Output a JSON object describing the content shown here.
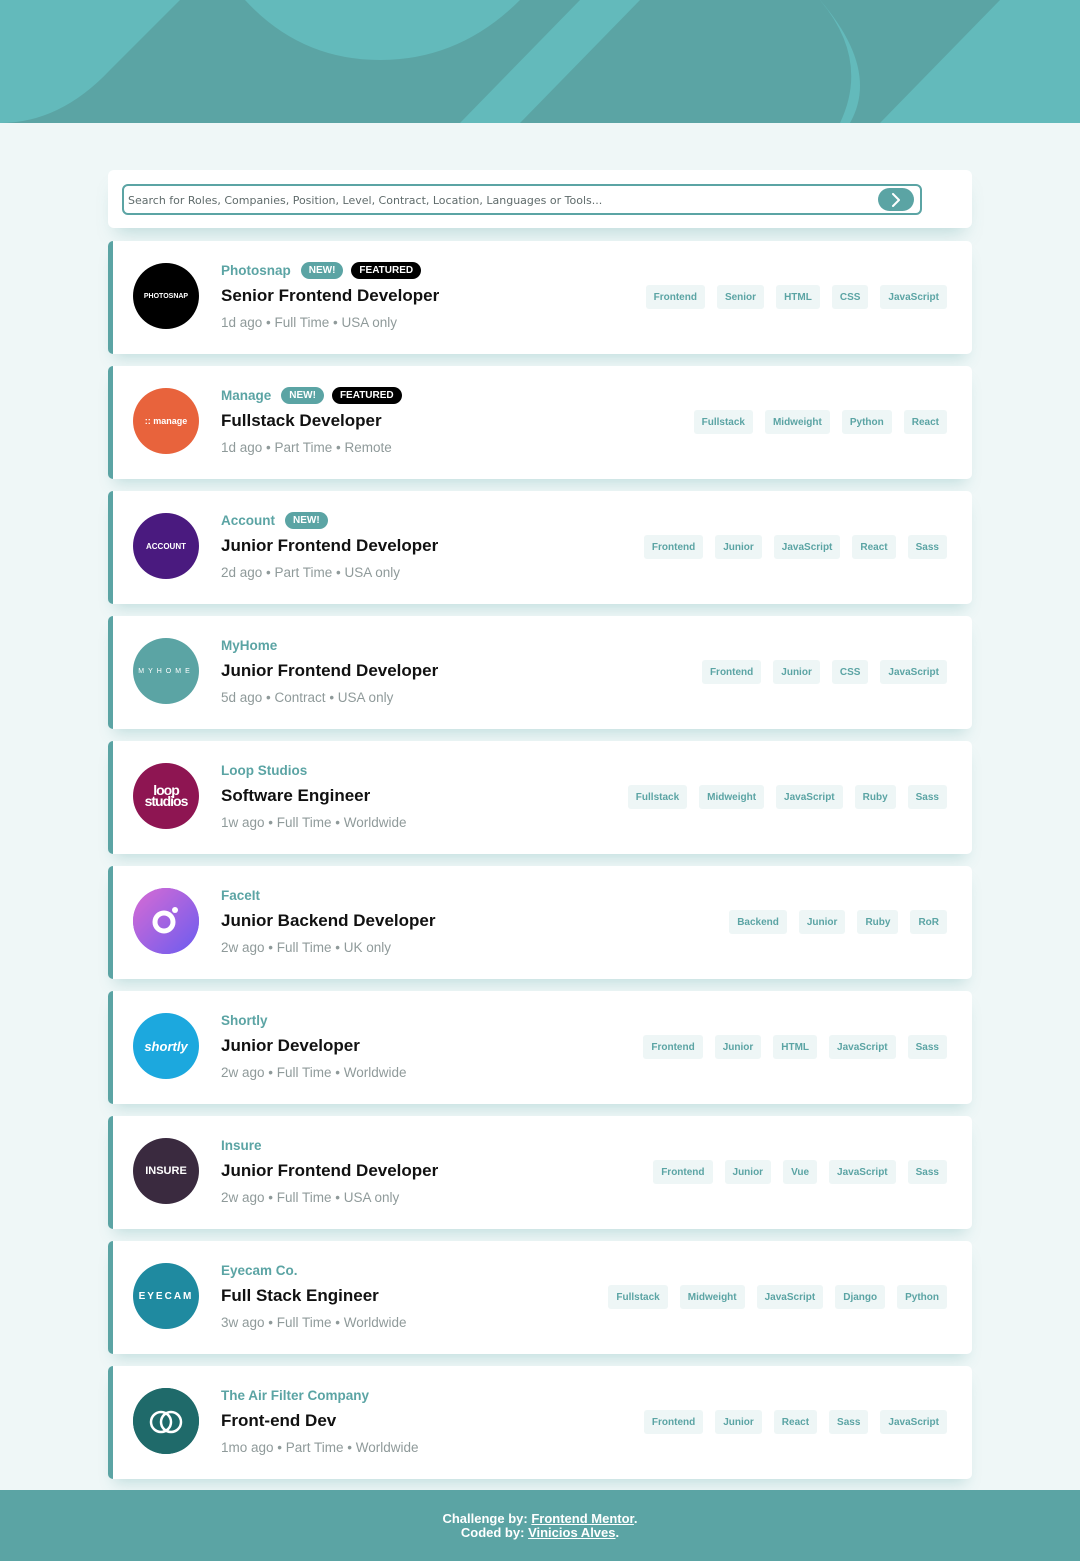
{
  "colors": {
    "primary": "#5ba4a4",
    "background": "#eff7f7",
    "tag_background": "#eef6f6",
    "featured": "#000000",
    "header_light": "#63babb"
  },
  "search": {
    "placeholder": "Search for Roles, Companies, Position, Level, Contract, Location, Languages or Tools...",
    "value": "",
    "button_icon": "chevron-right-icon"
  },
  "jobs": [
    {
      "company": "Photosnap",
      "new": "NEW!",
      "featured": "FEATURED",
      "position": "Senior Frontend Developer",
      "posted": "1d ago",
      "contract": "Full Time",
      "location": "USA only",
      "logo_text": "PHOTOSNAP",
      "logo_color": "#000000",
      "tags": [
        "Frontend",
        "Senior",
        "HTML",
        "CSS",
        "JavaScript"
      ]
    },
    {
      "company": "Manage",
      "new": "NEW!",
      "featured": "FEATURED",
      "position": "Fullstack Developer",
      "posted": "1d ago",
      "contract": "Part Time",
      "location": "Remote",
      "logo_text": ":: manage",
      "logo_color": "#e8633c",
      "tags": [
        "Fullstack",
        "Midweight",
        "Python",
        "React"
      ]
    },
    {
      "company": "Account",
      "new": "NEW!",
      "featured": "",
      "position": "Junior Frontend Developer",
      "posted": "2d ago",
      "contract": "Part Time",
      "location": "USA only",
      "logo_text": "ACCOUNT",
      "logo_color": "#4a1a7f",
      "tags": [
        "Frontend",
        "Junior",
        "JavaScript",
        "React",
        "Sass"
      ]
    },
    {
      "company": "MyHome",
      "new": "",
      "featured": "",
      "position": "Junior Frontend Developer",
      "posted": "5d ago",
      "contract": "Contract",
      "location": "USA only",
      "logo_text": "MYHOME",
      "logo_color": "#5ba4a4",
      "tags": [
        "Frontend",
        "Junior",
        "CSS",
        "JavaScript"
      ]
    },
    {
      "company": "Loop Studios",
      "new": "",
      "featured": "",
      "position": "Software Engineer",
      "posted": "1w ago",
      "contract": "Full Time",
      "location": "Worldwide",
      "logo_text": "loop studios",
      "logo_color": "#8e1552",
      "tags": [
        "Fullstack",
        "Midweight",
        "JavaScript",
        "Ruby",
        "Sass"
      ]
    },
    {
      "company": "FaceIt",
      "new": "",
      "featured": "",
      "position": "Junior Backend Developer",
      "posted": "2w ago",
      "contract": "Full Time",
      "location": "UK only",
      "logo_text": "",
      "logo_color": "#9b5de5",
      "tags": [
        "Backend",
        "Junior",
        "Ruby",
        "RoR"
      ]
    },
    {
      "company": "Shortly",
      "new": "",
      "featured": "",
      "position": "Junior Developer",
      "posted": "2w ago",
      "contract": "Full Time",
      "location": "Worldwide",
      "logo_text": "shortly",
      "logo_color": "#1ca8de",
      "tags": [
        "Frontend",
        "Junior",
        "HTML",
        "JavaScript",
        "Sass"
      ]
    },
    {
      "company": "Insure",
      "new": "",
      "featured": "",
      "position": "Junior Frontend Developer",
      "posted": "2w ago",
      "contract": "Full Time",
      "location": "USA only",
      "logo_text": "INSURE",
      "logo_color": "#3a2a3f",
      "tags": [
        "Frontend",
        "Junior",
        "Vue",
        "JavaScript",
        "Sass"
      ]
    },
    {
      "company": "Eyecam Co.",
      "new": "",
      "featured": "",
      "position": "Full Stack Engineer",
      "posted": "3w ago",
      "contract": "Full Time",
      "location": "Worldwide",
      "logo_text": "EYECAM",
      "logo_color": "#1f8aa0",
      "tags": [
        "Fullstack",
        "Midweight",
        "JavaScript",
        "Django",
        "Python"
      ]
    },
    {
      "company": "The Air Filter Company",
      "new": "",
      "featured": "",
      "position": "Front-end Dev",
      "posted": "1mo ago",
      "contract": "Part Time",
      "location": "Worldwide",
      "logo_text": "",
      "logo_color": "#1f6a6a",
      "tags": [
        "Frontend",
        "Junior",
        "React",
        "Sass",
        "JavaScript"
      ]
    }
  ],
  "footer": {
    "challenge_prefix": "Challenge by:",
    "challenge_link": "Frontend Mentor",
    "coded_prefix": "Coded by:",
    "coded_link": "Vinicios Alves",
    "period": "."
  }
}
